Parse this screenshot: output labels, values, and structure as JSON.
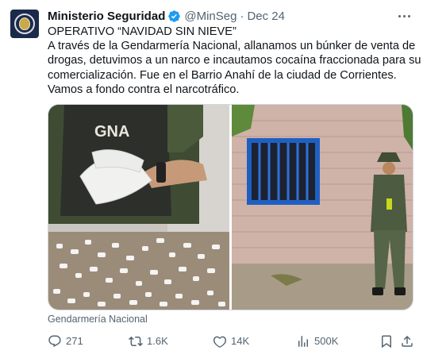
{
  "tweet": {
    "author_name": "Ministerio Seguridad",
    "handle": "@MinSeg",
    "separator": "·",
    "date": "Dec 24",
    "text_lines": [
      "OPERATIVO “NAVIDAD SIN NIEVE”",
      "A través de la Gendarmería Nacional, allanamos un búnker de venta de",
      "drogas, detuvimos a un narco e incautamos cocaína fraccionada para su",
      "comercialización. Fue en el Barrio Anahí de la ciudad de Corrientes.",
      "Vamos a fondo contra el narcotráfico."
    ],
    "media": {
      "left_image": {
        "vest_text": "GNA"
      },
      "right_image": {}
    },
    "media_caption": "Gendarmería Nacional",
    "actions": {
      "replies": "271",
      "reposts": "1.6K",
      "likes": "14K",
      "views": "500K"
    }
  },
  "icons": [
    "verified-badge-icon",
    "more-options-icon",
    "reply-icon",
    "repost-icon",
    "like-icon",
    "views-icon",
    "bookmark-icon",
    "share-icon"
  ],
  "colors": {
    "text": "#0f1419",
    "secondary": "#536471",
    "verified": "#1d9bf0",
    "border": "#cfd9de"
  }
}
